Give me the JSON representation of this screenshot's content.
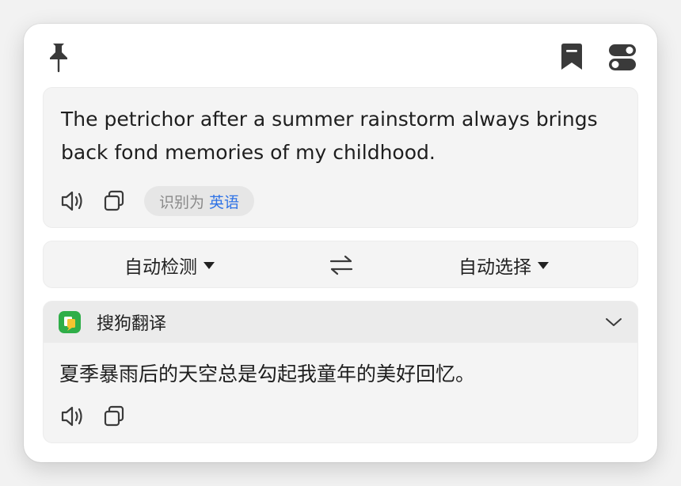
{
  "toolbar": {
    "pin_icon": "pin-icon",
    "bookmark_icon": "bookmark-icon",
    "settings_icon": "toggle-settings-icon"
  },
  "source": {
    "text": "The petrichor after a summer rainstorm always brings back fond memories of my childhood.",
    "detect_prefix": "识别为",
    "detect_lang": "英语",
    "speak_icon": "speaker-icon",
    "copy_icon": "copy-icon"
  },
  "language_bar": {
    "source_lang": "自动检测",
    "target_lang": "自动选择",
    "swap_icon": "swap-icon"
  },
  "result": {
    "provider": "搜狗翻译",
    "text": "夏季暴雨后的天空总是勾起我童年的美好回忆。",
    "speak_icon": "speaker-icon",
    "copy_icon": "copy-icon"
  },
  "colors": {
    "accent": "#2f73e6",
    "icon": "#3a3a3a",
    "provider_logo": "#2fae48"
  }
}
